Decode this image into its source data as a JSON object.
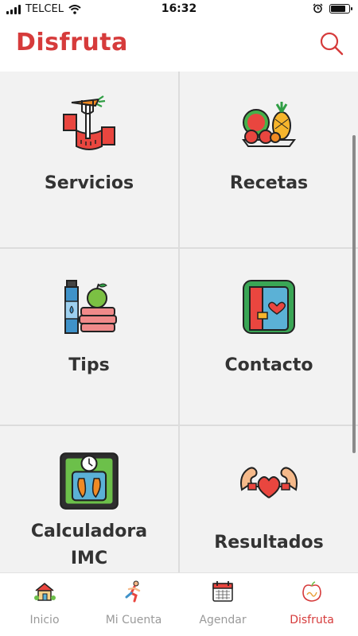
{
  "status_bar": {
    "carrier": "TELCEL",
    "time": "16:32",
    "battery_level": 0.85
  },
  "header": {
    "title": "Disfruta",
    "search_icon": "search-icon"
  },
  "tiles": [
    {
      "label": "Servicios",
      "icon": "fork-carrot-tape-measure-icon"
    },
    {
      "label": "Recetas",
      "icon": "fruit-bowl-icon"
    },
    {
      "label": "Tips",
      "icon": "bottle-apple-towels-icon"
    },
    {
      "label": "Contacto",
      "icon": "heart-notebook-icon"
    },
    {
      "label": "Calculadora IMC",
      "label_line1": "Calculadora",
      "label_line2": "IMC",
      "icon": "bathroom-scale-icon"
    },
    {
      "label": "Resultados",
      "icon": "flexing-heart-icon"
    }
  ],
  "tab_bar": {
    "active": "Disfruta",
    "items": [
      {
        "label": "Inicio",
        "icon": "house-icon"
      },
      {
        "label": "Mi Cuenta",
        "icon": "running-person-icon"
      },
      {
        "label": "Agendar",
        "icon": "calendar-icon"
      },
      {
        "label": "Disfruta",
        "icon": "apple-logo-icon"
      }
    ]
  },
  "colors": {
    "accent": "#d63b3b",
    "tile_background": "#f2f2f2",
    "inactive_tab": "#9a9a9a"
  }
}
